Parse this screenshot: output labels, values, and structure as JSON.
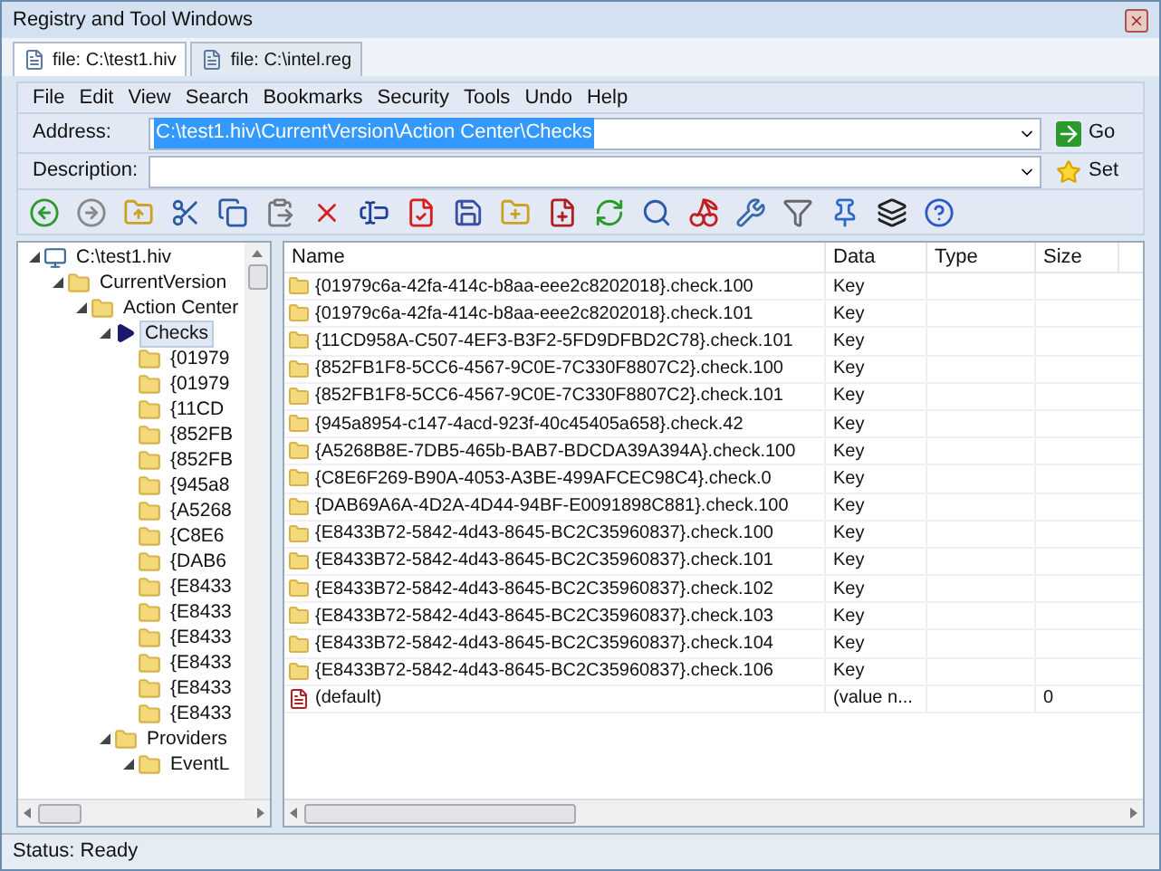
{
  "window": {
    "title": "Registry and Tool Windows"
  },
  "tabs": [
    {
      "label": "file: C:\\test1.hiv",
      "selected": true
    },
    {
      "label": "file: C:\\intel.reg",
      "selected": false
    }
  ],
  "menu": [
    "File",
    "Edit",
    "View",
    "Search",
    "Bookmarks",
    "Security",
    "Tools",
    "Undo",
    "Help"
  ],
  "address": {
    "label": "Address:",
    "value": "C:\\test1.hiv\\CurrentVersion\\Action Center\\Checks",
    "selected": true,
    "button": "Go"
  },
  "description": {
    "label": "Description:",
    "button": "Set"
  },
  "tree": [
    {
      "label": "C:\\test1.hiv",
      "kind": "computer",
      "selected": false,
      "expanded": true,
      "children": [
        {
          "label": "CurrentVersion",
          "kind": "folder",
          "selected": false,
          "expanded": true,
          "children": [
            {
              "label": "Action Center",
              "kind": "folder",
              "selected": false,
              "expanded": true,
              "children": [
                {
                  "label": "Checks",
                  "kind": "folder",
                  "selected": true,
                  "expanded": true,
                  "children": [
                    {
                      "label": "{01979",
                      "kind": "folder",
                      "selected": false
                    },
                    {
                      "label": "{01979",
                      "kind": "folder",
                      "selected": false
                    },
                    {
                      "label": "{11CD",
                      "kind": "folder",
                      "selected": false
                    },
                    {
                      "label": "{852FB",
                      "kind": "folder",
                      "selected": false
                    },
                    {
                      "label": "{852FB",
                      "kind": "folder",
                      "selected": false
                    },
                    {
                      "label": "{945a8",
                      "kind": "folder",
                      "selected": false
                    },
                    {
                      "label": "{A5268",
                      "kind": "folder",
                      "selected": false
                    },
                    {
                      "label": "{C8E6",
                      "kind": "folder",
                      "selected": false
                    },
                    {
                      "label": "{DAB6",
                      "kind": "folder",
                      "selected": false
                    },
                    {
                      "label": "{E8433",
                      "kind": "folder",
                      "selected": false
                    },
                    {
                      "label": "{E8433",
                      "kind": "folder",
                      "selected": false
                    },
                    {
                      "label": "{E8433",
                      "kind": "folder",
                      "selected": false
                    },
                    {
                      "label": "{E8433",
                      "kind": "folder",
                      "selected": false
                    },
                    {
                      "label": "{E8433",
                      "kind": "folder",
                      "selected": false
                    },
                    {
                      "label": "{E8433",
                      "kind": "folder",
                      "selected": false
                    }
                  ]
                },
                {
                  "label": "Providers",
                  "kind": "folder",
                  "selected": false,
                  "expanded": true,
                  "children": [
                    {
                      "label": "EventL",
                      "kind": "folder",
                      "selected": false,
                      "expanded": true
                    }
                  ]
                }
              ]
            }
          ]
        }
      ]
    }
  ],
  "table": {
    "columns": [
      "Name",
      "Data",
      "Type",
      "Size"
    ],
    "rows": [
      {
        "kind": "key",
        "name": "{01979c6a-42fa-414c-b8aa-eee2c8202018}.check.100",
        "data": "Key"
      },
      {
        "kind": "key",
        "name": "{01979c6a-42fa-414c-b8aa-eee2c8202018}.check.101",
        "data": "Key"
      },
      {
        "kind": "key",
        "name": "{11CD958A-C507-4EF3-B3F2-5FD9DFBD2C78}.check.101",
        "data": "Key"
      },
      {
        "kind": "key",
        "name": "{852FB1F8-5CC6-4567-9C0E-7C330F8807C2}.check.100",
        "data": "Key"
      },
      {
        "kind": "key",
        "name": "{852FB1F8-5CC6-4567-9C0E-7C330F8807C2}.check.101",
        "data": "Key"
      },
      {
        "kind": "key",
        "name": "{945a8954-c147-4acd-923f-40c45405a658}.check.42",
        "data": "Key"
      },
      {
        "kind": "key",
        "name": "{A5268B8E-7DB5-465b-BAB7-BDCDA39A394A}.check.100",
        "data": "Key"
      },
      {
        "kind": "key",
        "name": "{C8E6F269-B90A-4053-A3BE-499AFCEC98C4}.check.0",
        "data": "Key"
      },
      {
        "kind": "key",
        "name": "{DAB69A6A-4D2A-4D44-94BF-E0091898C881}.check.100",
        "data": "Key"
      },
      {
        "kind": "key",
        "name": "{E8433B72-5842-4d43-8645-BC2C35960837}.check.100",
        "data": "Key"
      },
      {
        "kind": "key",
        "name": "{E8433B72-5842-4d43-8645-BC2C35960837}.check.101",
        "data": "Key"
      },
      {
        "kind": "key",
        "name": "{E8433B72-5842-4d43-8645-BC2C35960837}.check.102",
        "data": "Key"
      },
      {
        "kind": "key",
        "name": "{E8433B72-5842-4d43-8645-BC2C35960837}.check.103",
        "data": "Key"
      },
      {
        "kind": "key",
        "name": "{E8433B72-5842-4d43-8645-BC2C35960837}.check.104",
        "data": "Key"
      },
      {
        "kind": "key",
        "name": "{E8433B72-5842-4d43-8645-BC2C35960837}.check.106",
        "data": "Key"
      },
      {
        "kind": "value",
        "name": "(default)",
        "data": "(value n...",
        "size": "0"
      }
    ]
  },
  "status_bar": "Status: Ready"
}
